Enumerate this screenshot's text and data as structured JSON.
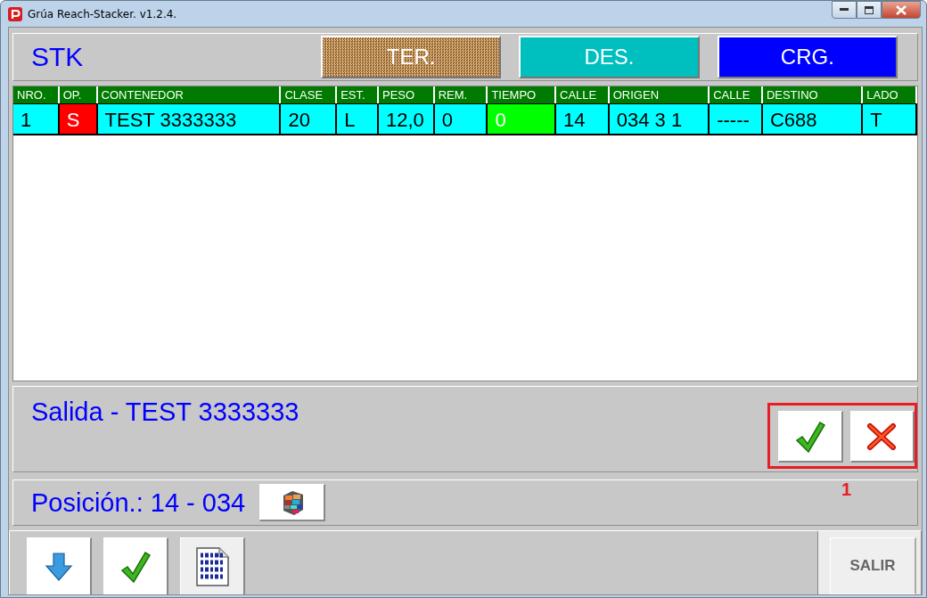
{
  "window": {
    "title": "Grúa Reach-Stacker. v1.2.4."
  },
  "header": {
    "title": "STK",
    "modes": [
      {
        "label": "TER.",
        "color": "#8b5a2b",
        "selected": true
      },
      {
        "label": "DES.",
        "color": "#00bfbf",
        "selected": false
      },
      {
        "label": "CRG.",
        "color": "#0000ff",
        "selected": false
      }
    ]
  },
  "table": {
    "columns": [
      "NRO.",
      "OP.",
      "CONTENEDOR",
      "CLASE",
      "EST.",
      "PESO",
      "REM.",
      "TIEMPO",
      "CALLE",
      "ORIGEN",
      "CALLE",
      "DESTINO",
      "LADO"
    ],
    "rows": [
      {
        "cells": [
          {
            "text": "1"
          },
          {
            "text": "S",
            "color": "#ff0000"
          },
          {
            "text": "TEST 3333333"
          },
          {
            "text": "20"
          },
          {
            "text": "L"
          },
          {
            "text": "12,0"
          },
          {
            "text": "0"
          },
          {
            "text": "0",
            "color": "#00ff00"
          },
          {
            "text": "14"
          },
          {
            "text": "034 3 1"
          },
          {
            "text": "-----"
          },
          {
            "text": "C688"
          },
          {
            "text": "T"
          }
        ]
      }
    ]
  },
  "message": {
    "text": "Salida - TEST 3333333",
    "annotation": "1"
  },
  "position": {
    "text": "Posición.: 14 - 034"
  },
  "footer": {
    "exit_button": "SALIR"
  }
}
